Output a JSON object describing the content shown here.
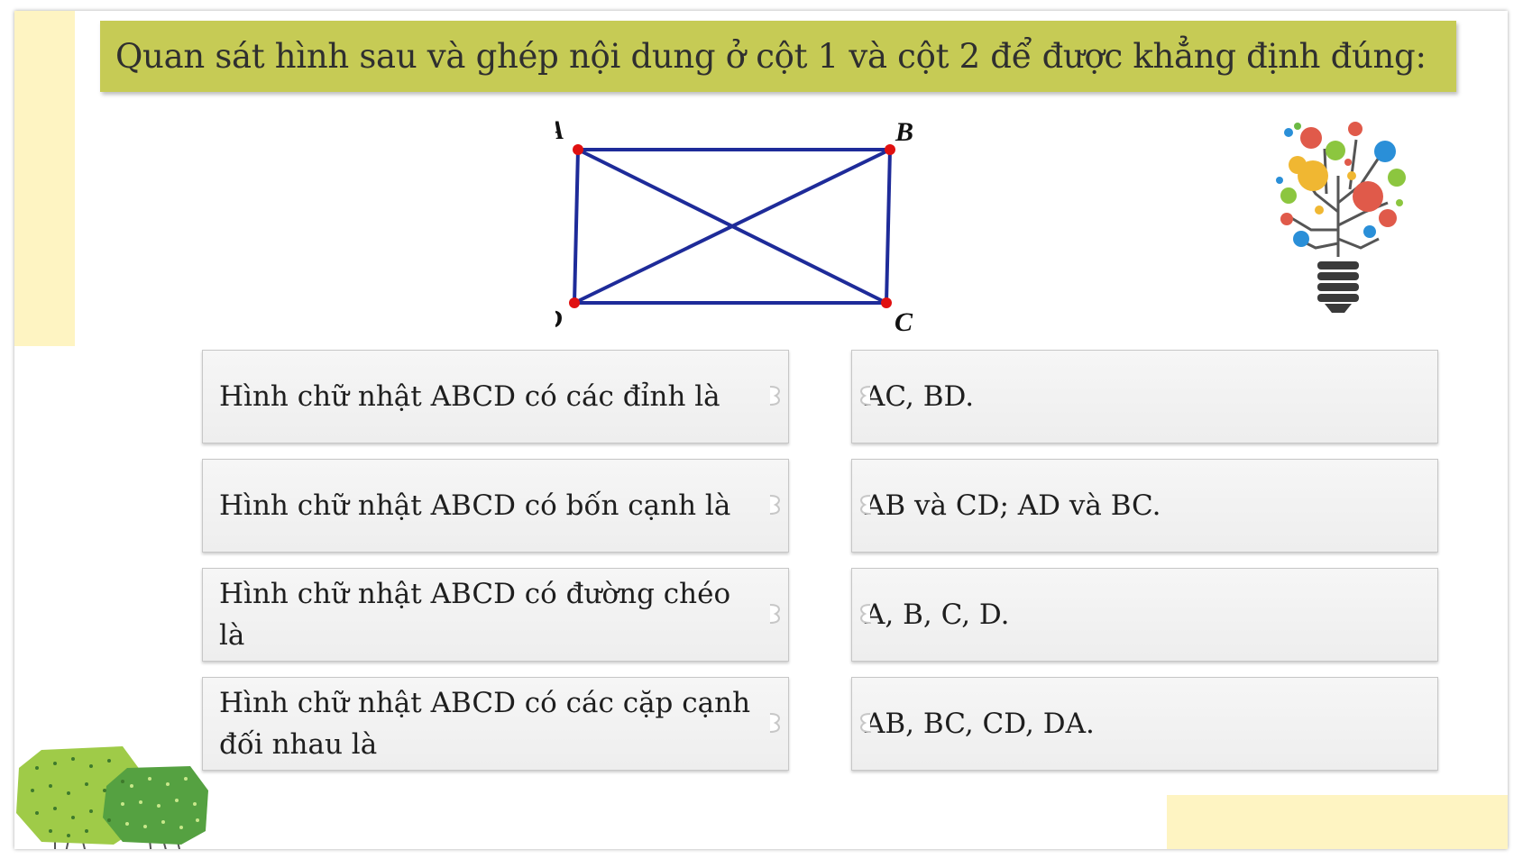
{
  "title": "Quan sát hình sau và ghép nội dung ở cột 1 và cột 2 để được khẳng định đúng:",
  "figure": {
    "vertices": [
      "A",
      "B",
      "C",
      "D"
    ],
    "line_color": "#1e2b99",
    "point_color": "#e01010"
  },
  "column1": [
    {
      "text": "Hình chữ nhật ABCD có các đỉnh là"
    },
    {
      "text": "Hình chữ nhật ABCD có bốn cạnh là"
    },
    {
      "text": "Hình chữ nhật ABCD có đường chéo là"
    },
    {
      "text": "Hình chữ nhật ABCD có các cặp cạnh đối nhau là"
    }
  ],
  "column2": [
    {
      "text": "AC, BD."
    },
    {
      "text": "AB và CD; AD và BC."
    },
    {
      "text": "A, B, C, D."
    },
    {
      "text": "AB, BC, CD, DA."
    }
  ],
  "colors": {
    "title_bar": "#c6cb55",
    "accent_panel": "#fef4c2",
    "card_bg": "#f2f2f2"
  }
}
